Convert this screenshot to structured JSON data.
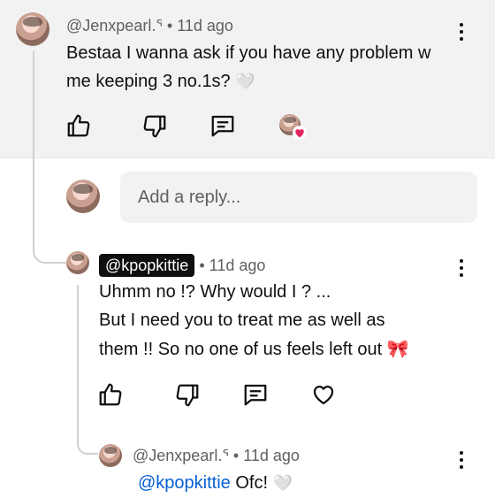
{
  "comment": {
    "username": "@Jenxpearl.ᕐ",
    "separator": "•",
    "time": "11d ago",
    "lines": [
      "Bestaa I wanna ask if you have any problem w",
      "me keeping 3 no.1s?"
    ],
    "emoji": "🤍"
  },
  "reply_input": {
    "placeholder": "Add a reply..."
  },
  "reply1": {
    "username": "@kpopkittie",
    "separator": "•",
    "time": "11d ago",
    "lines": [
      "Uhmm no !? Why would I ? ...",
      "But I need you to treat me as well as",
      "them !! So no one of us feels left out"
    ],
    "emoji": "🎀"
  },
  "reply2": {
    "username": "@Jenxpearl.ᕐ",
    "separator": "•",
    "time": "11d ago",
    "mention": "@kpopkittie",
    "text": " Ofc!",
    "emoji": "🤍"
  },
  "colors": {
    "mention": "#065fd4",
    "heart_badge": "#e0245e",
    "section_bg": "#f2f2f2"
  }
}
